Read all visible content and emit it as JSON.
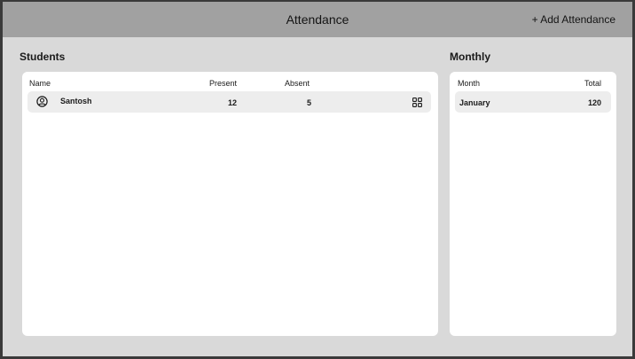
{
  "header": {
    "title": "Attendance",
    "add_button_label": "+ Add Attendance"
  },
  "students": {
    "title": "Students",
    "columns": [
      "Name",
      "Present",
      "Absent"
    ],
    "rows": [
      {
        "avatar_icon": "user-circle-icon",
        "name": "Santosh",
        "present": "12",
        "absent": "5",
        "action_icon": "grid-icon"
      }
    ]
  },
  "monthly": {
    "title": "Monthly",
    "columns": [
      "Month",
      "Total"
    ],
    "rows": [
      {
        "month": "January",
        "total": "120"
      }
    ]
  }
}
